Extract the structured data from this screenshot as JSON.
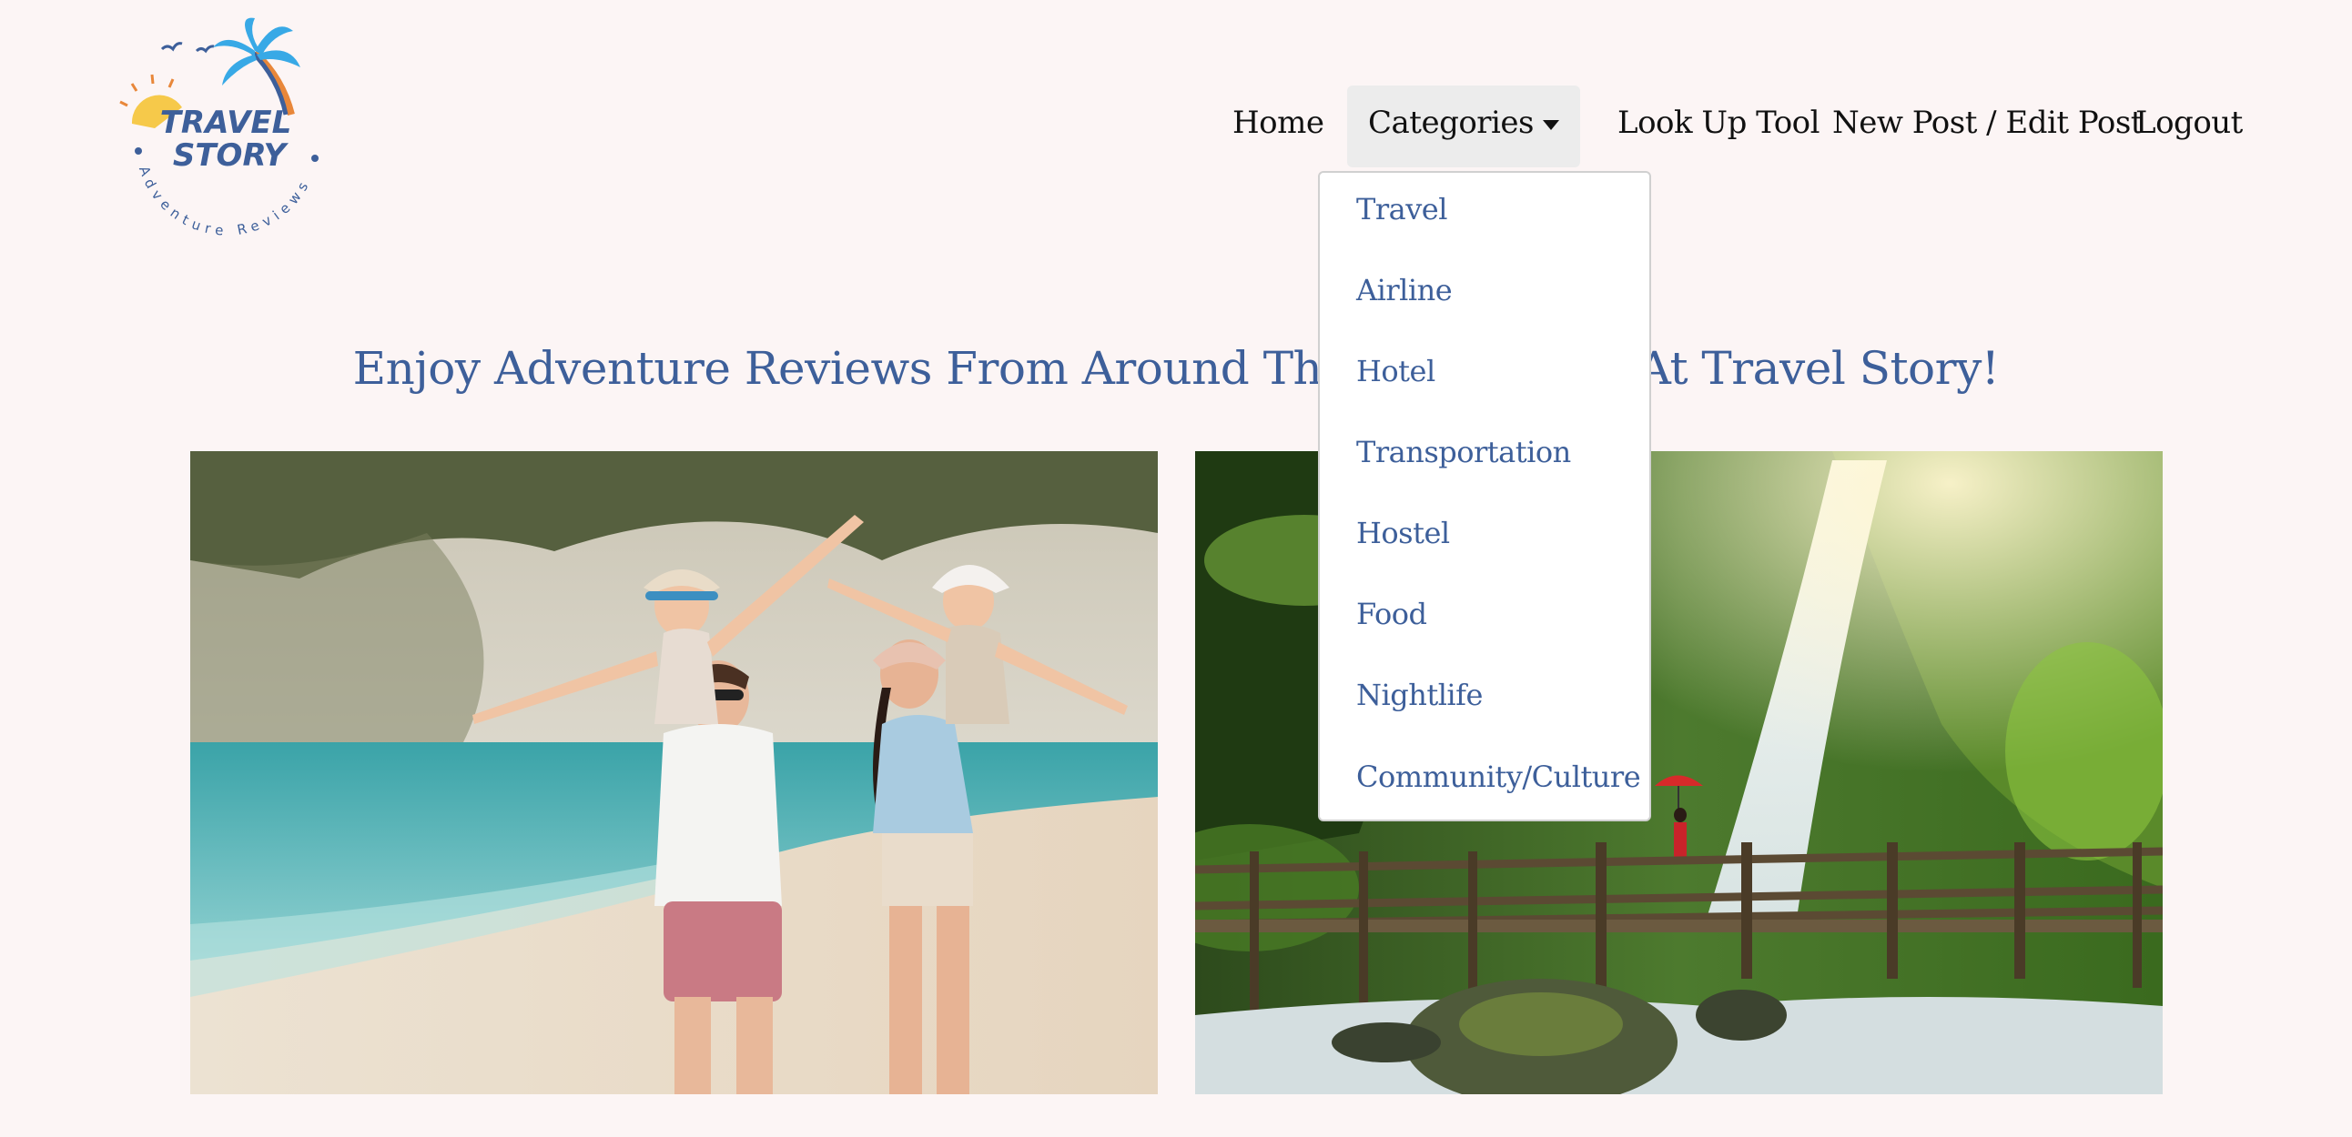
{
  "logo": {
    "line1": "TRAVEL",
    "line2": "STORY",
    "tagline": "Adventure Reviews",
    "colors": {
      "palm": "#38a9e6",
      "text": "#3d5f9a",
      "sun": "#f6c94a",
      "orange": "#e8873a"
    }
  },
  "nav": {
    "home": "Home",
    "categories": "Categories",
    "lookup": "Look Up Tool",
    "new_post": "New Post / Edit Post",
    "logout": "Logout"
  },
  "dropdown": {
    "items": [
      "Travel",
      "Airline",
      "Hotel",
      "Transportation",
      "Hostel",
      "Food",
      "Nightlife",
      "Community/Culture"
    ]
  },
  "headline": "Enjoy Adventure Reviews From Around The World Here At Travel Story!",
  "photos": [
    {
      "subject": "family-on-beach"
    },
    {
      "subject": "waterfall-bridge"
    }
  ],
  "colors": {
    "background": "#fcf5f5",
    "accent": "#3d5f9a",
    "nav_text": "#111111",
    "active_nav_bg": "#ececec"
  }
}
